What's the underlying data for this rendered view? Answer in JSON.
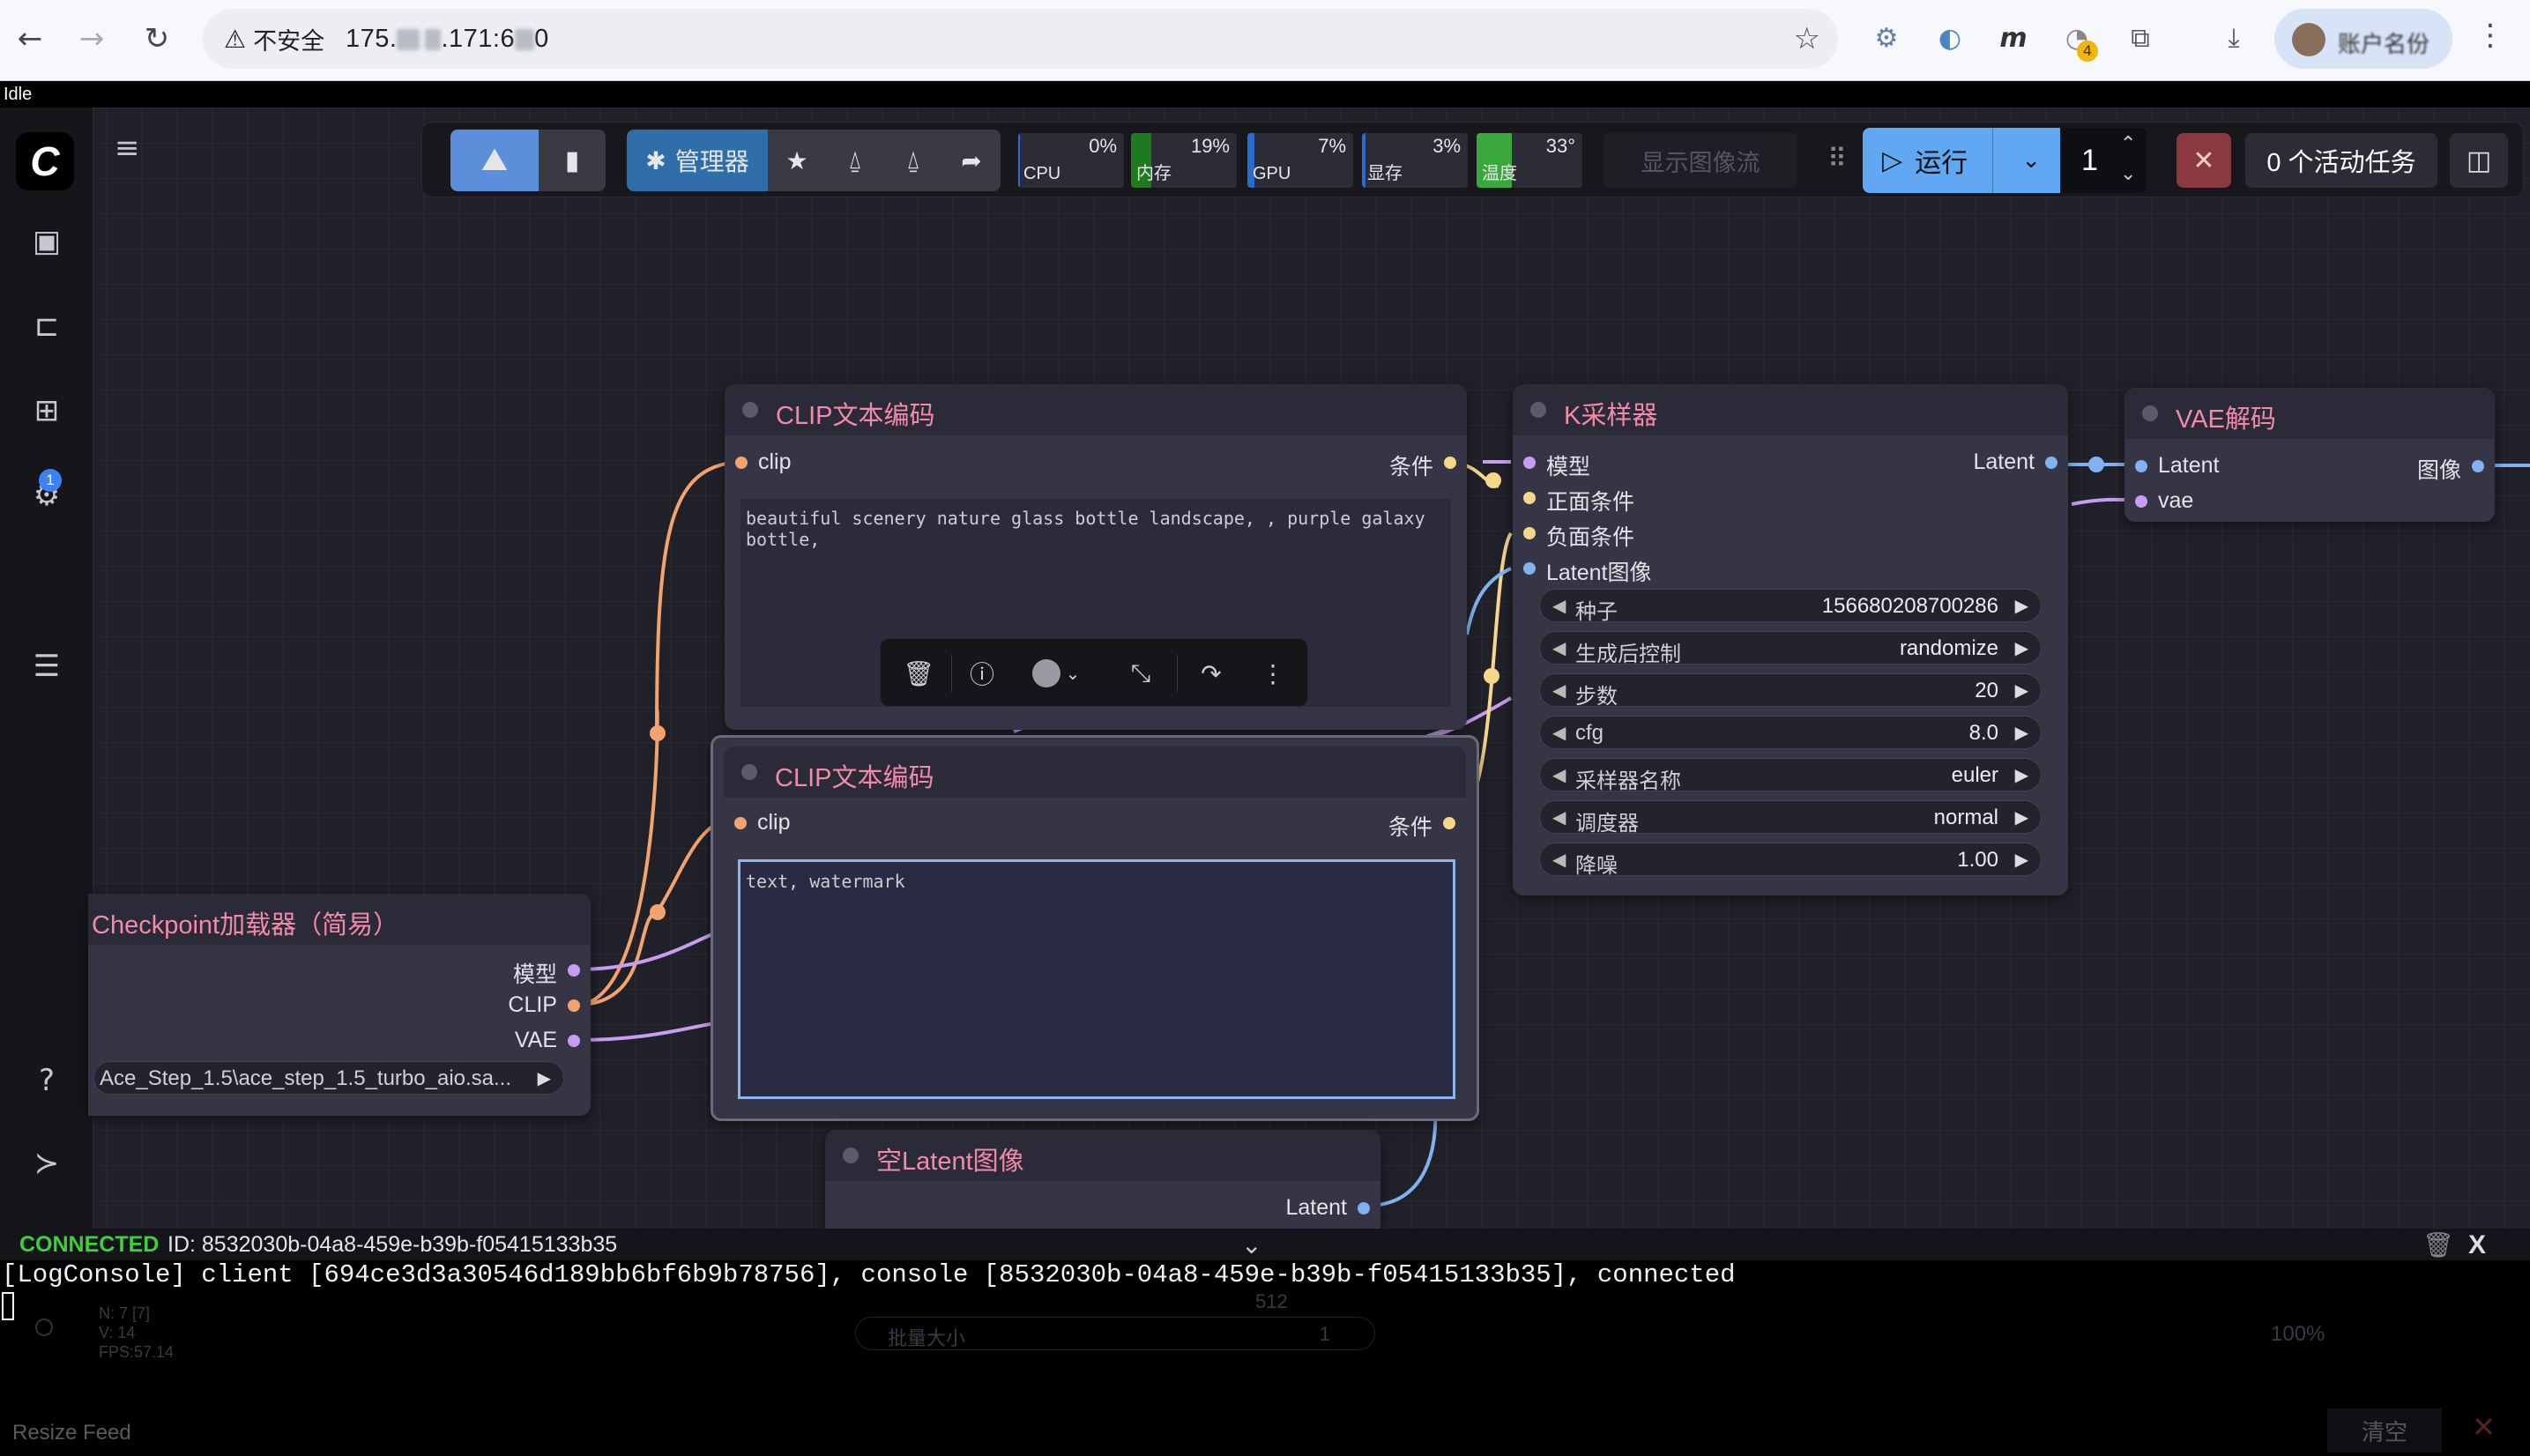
{
  "browser": {
    "back": "←",
    "forward": "→",
    "reload": "↻",
    "warning_glyph": "⚠",
    "not_secure": "不安全",
    "url_prefix": "175.",
    "url_mid": ".171:6",
    "url_suffix": "0",
    "star": "☆",
    "profile_name": "账户名份",
    "menu": "⋮",
    "extensions": [
      "translate-icon",
      "edge-icon",
      "m-icon",
      "badge-ext-icon",
      "puzzle-icon",
      "download-icon"
    ],
    "ext_badge": "4"
  },
  "status_strip": "Idle",
  "sidebar": {
    "logo": "C",
    "badge": "1",
    "hamburger": "≡"
  },
  "toolbar": {
    "manager_label": "管理器",
    "meters": [
      {
        "label": "CPU",
        "value": "0%",
        "level": 0,
        "color": "#2a6bd1"
      },
      {
        "label": "内存",
        "value": "19%",
        "level": 19,
        "color": "#1f7a1f"
      },
      {
        "label": "GPU",
        "value": "7%",
        "level": 7,
        "color": "#2a6bd1"
      },
      {
        "label": "显存",
        "value": "3%",
        "level": 3,
        "color": "#2a6bd1"
      },
      {
        "label": "温度",
        "value": "33°",
        "level": 33,
        "color": "#3aa83a"
      }
    ],
    "show_image_flow": "显示图像流",
    "run_label": "运行",
    "batch_count": "1",
    "queue_label": "0 个活动任务"
  },
  "nodes": {
    "clip1": {
      "title": "CLIP文本编码",
      "input": "clip",
      "output": "条件",
      "text": "beautiful scenery nature glass bottle landscape, , purple galaxy bottle,"
    },
    "clip2": {
      "title": "CLIP文本编码",
      "input": "clip",
      "output": "条件",
      "text": "text, watermark"
    },
    "ksampler": {
      "title": "K采样器",
      "inputs": [
        "模型",
        "正面条件",
        "负面条件",
        "Latent图像"
      ],
      "output": "Latent",
      "widgets": [
        {
          "label": "种子",
          "value": "156680208700286"
        },
        {
          "label": "生成后控制",
          "value": "randomize"
        },
        {
          "label": "步数",
          "value": "20"
        },
        {
          "label": "cfg",
          "value": "8.0"
        },
        {
          "label": "采样器名称",
          "value": "euler"
        },
        {
          "label": "调度器",
          "value": "normal"
        },
        {
          "label": "降噪",
          "value": "1.00"
        }
      ]
    },
    "vae": {
      "title": "VAE解码",
      "inputs": [
        "Latent",
        "vae"
      ],
      "output": "图像"
    },
    "checkpoint": {
      "title": "Checkpoint加载器（简易）",
      "outputs": [
        "模型",
        "CLIP",
        "VAE"
      ],
      "ckpt": "Ace_Step_1.5\\ace_step_1.5_turbo_aio.sa..."
    },
    "empty_latent": {
      "title": "空Latent图像",
      "output": "Latent",
      "ghost_value": "512",
      "ghost_batch_label": "批量大小",
      "ghost_batch_value": "1"
    }
  },
  "status_bar": {
    "status": "CONNECTED",
    "id": "ID: 8532030b-04a8-459e-b39b-f05415133b35",
    "close": "X"
  },
  "log": {
    "line": "[LogConsole] client [694ce3d3a30546d189bb6bf6b9b78756], console [8532030b-04a8-459e-b39b-f05415133b35], connected"
  },
  "ghosts": {
    "n": "N: 7 [7]",
    "v": "V: 14",
    "fps": "FPS:57.14",
    "zoom": "100%",
    "resize_feed": "Resize Feed",
    "clear": "清空"
  }
}
